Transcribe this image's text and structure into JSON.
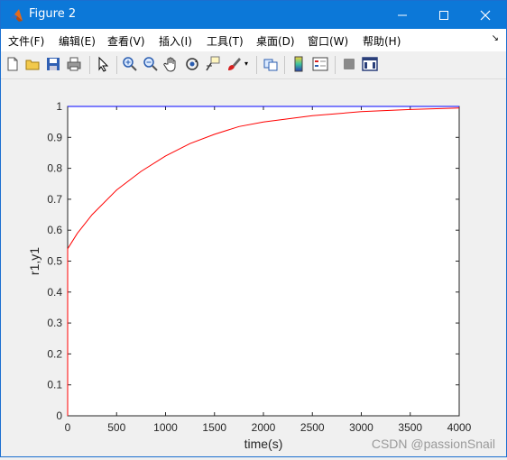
{
  "window": {
    "title": "Figure 2",
    "minimize_glyph": "—",
    "maximize_glyph": "☐",
    "close_glyph": "✕"
  },
  "menu": [
    "文件(F)",
    "编辑(E)",
    "查看(V)",
    "插入(I)",
    "工具(T)",
    "桌面(D)",
    "窗口(W)",
    "帮助(H)"
  ],
  "menu_overflow_glyph": "↘",
  "toolbar_icons": [
    "new-figure-icon",
    "open-file-icon",
    "save-icon",
    "print-icon",
    "pointer-icon",
    "zoom-in-icon",
    "zoom-out-icon",
    "pan-icon",
    "rotate-3d-icon",
    "data-cursor-icon",
    "brush-icon",
    "brush-dropdown-icon",
    "link-plot-icon",
    "colorbar-icon",
    "legend-icon",
    "hide-plot-tools-icon",
    "show-plot-tools-icon"
  ],
  "watermark": "CSDN @passionSnail",
  "colors": {
    "titlebar": "#0c78d8",
    "series_blue": "#0000ff",
    "series_red": "#ff0000"
  },
  "chart_data": {
    "type": "line",
    "title": "",
    "xlabel": "time(s)",
    "ylabel": "r1,y1",
    "xlim": [
      0,
      4000
    ],
    "ylim": [
      0,
      1
    ],
    "xticks": [
      0,
      500,
      1000,
      1500,
      2000,
      2500,
      3000,
      3500,
      4000
    ],
    "yticks": [
      0,
      0.1,
      0.2,
      0.3,
      0.4,
      0.5,
      0.6,
      0.7,
      0.8,
      0.9,
      1
    ],
    "xtick_labels": [
      "0",
      "500",
      "1000",
      "1500",
      "2000",
      "2500",
      "3000",
      "3500",
      "4000"
    ],
    "ytick_labels": [
      "0",
      "0.1",
      "0.2",
      "0.3",
      "0.4",
      "0.5",
      "0.6",
      "0.7",
      "0.8",
      "0.9",
      "1"
    ],
    "grid": false,
    "series": [
      {
        "color": "#0000ff",
        "x": [
          0,
          4000
        ],
        "y": [
          1,
          1
        ]
      },
      {
        "color": "#ff0000",
        "x": [
          0,
          0,
          100,
          250,
          500,
          750,
          1000,
          1250,
          1500,
          1750,
          2000,
          2500,
          3000,
          3500,
          4000
        ],
        "y": [
          0,
          0.54,
          0.59,
          0.65,
          0.73,
          0.79,
          0.84,
          0.88,
          0.91,
          0.935,
          0.95,
          0.97,
          0.983,
          0.99,
          0.995
        ]
      }
    ]
  }
}
